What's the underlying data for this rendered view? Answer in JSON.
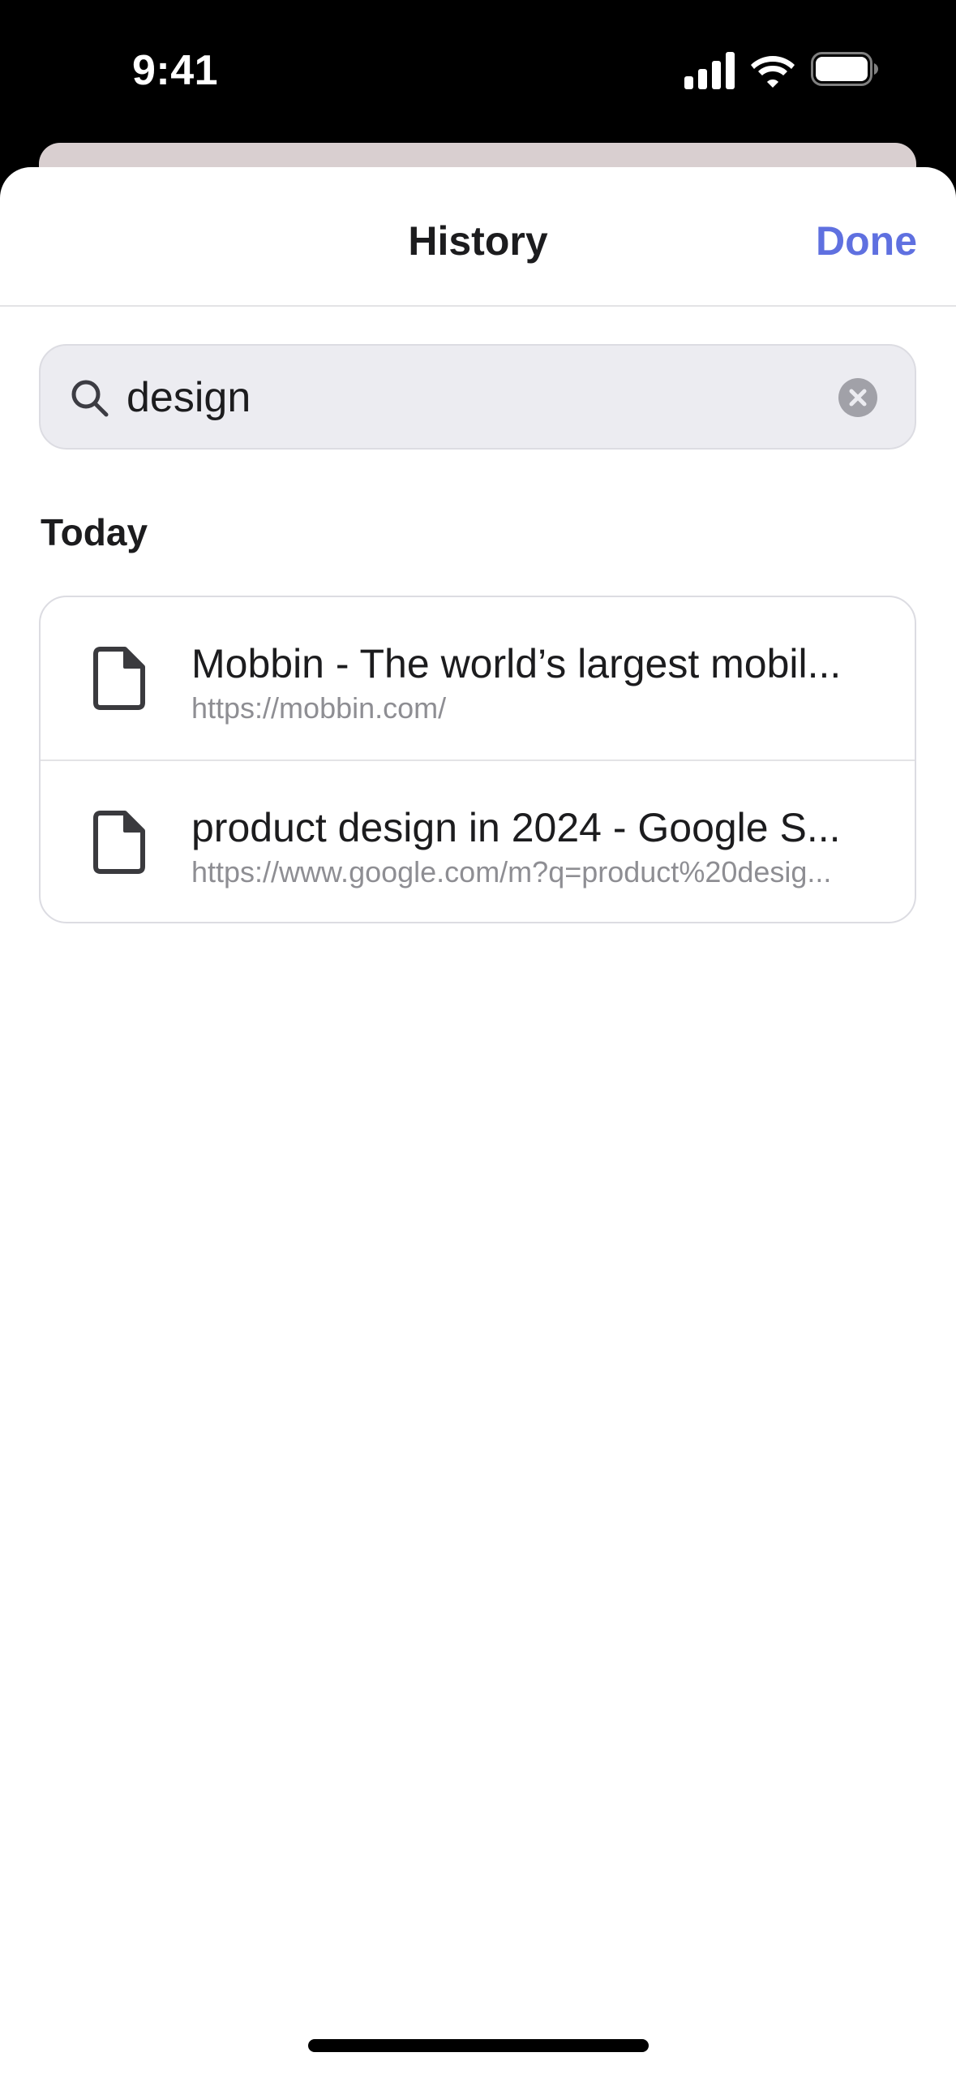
{
  "status_bar": {
    "time": "9:41",
    "signal_icon": "cellular-signal-icon",
    "wifi_icon": "wifi-icon",
    "battery_icon": "battery-icon"
  },
  "header": {
    "title": "History",
    "done_label": "Done"
  },
  "search": {
    "value": "design",
    "icon": "search-icon",
    "clear_icon": "clear-icon"
  },
  "section": {
    "title": "Today"
  },
  "history_items": [
    {
      "title": "Mobbin - The world’s largest mobil...",
      "url": "https://mobbin.com/",
      "icon": "document-icon"
    },
    {
      "title": "product design in 2024 - Google S...",
      "url": "https://www.google.com/m?q=product%20desig...",
      "icon": "document-icon"
    }
  ],
  "colors": {
    "accent": "#5f70e0",
    "text_primary": "#1c1c1e",
    "text_secondary": "#8e8e93",
    "search_background": "#ececf1",
    "divider": "#e3e3e6",
    "sheet_background": "#ffffff",
    "status_bar_background": "#000000"
  }
}
